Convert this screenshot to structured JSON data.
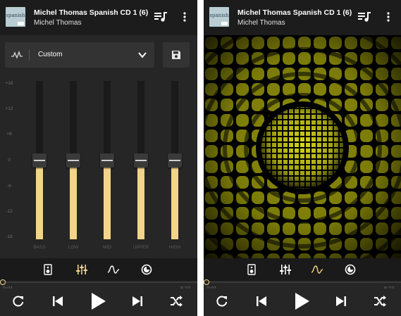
{
  "colors": {
    "accent": "#f3d48a",
    "background": "#262626",
    "header_bg": "#1c1c1c",
    "visualizer_yellow": "#e6e600"
  },
  "screens": [
    {
      "header": {
        "title": "Michel Thomas Spanish CD 1 (6)",
        "artist": "Michel Thomas",
        "album_art_text": "spanish",
        "queue_icon": "queue-music-icon",
        "more_icon": "more-vert-icon"
      },
      "preset": {
        "label": "Custom",
        "icon": "waveform-icon",
        "chevron": "chevron-down-icon",
        "save_icon": "save-icon"
      },
      "db_scale": [
        "+18",
        "+12",
        "+6",
        "0",
        "-6",
        "-12",
        "-18"
      ],
      "bands": [
        {
          "label": "BASS",
          "gain_db": 0
        },
        {
          "label": "LOW",
          "gain_db": 0
        },
        {
          "label": "MID",
          "gain_db": 0
        },
        {
          "label": "UPPER",
          "gain_db": 0
        },
        {
          "label": "HIGH",
          "gain_db": 0
        }
      ],
      "tabs": [
        "speaker-icon",
        "equalizer-icon",
        "wave-icon",
        "timer-icon"
      ],
      "active_tab": 1,
      "progress": {
        "elapsed": "0:01",
        "total": "6:22"
      }
    },
    {
      "header": {
        "title": "Michel Thomas Spanish CD 1 (6)",
        "artist": "Michel Thomas",
        "album_art_text": "spanish",
        "queue_icon": "queue-music-icon",
        "more_icon": "more-vert-icon"
      },
      "tabs": [
        "speaker-icon",
        "equalizer-icon",
        "wave-icon",
        "timer-icon"
      ],
      "active_tab": 2,
      "progress": {
        "elapsed": "0:01",
        "total": "6:22"
      }
    }
  ],
  "transport": [
    "repeat-icon",
    "skip-previous-icon",
    "play-icon",
    "skip-next-icon",
    "shuffle-icon"
  ]
}
